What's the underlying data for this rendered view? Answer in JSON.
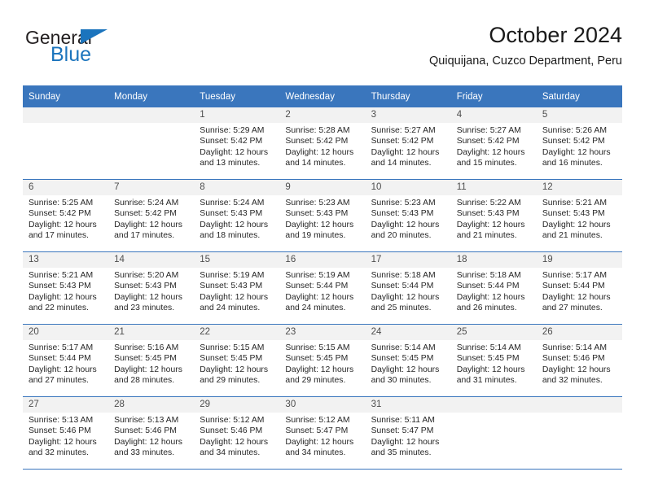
{
  "brand": {
    "name_part1": "General",
    "name_part2": "Blue",
    "accent_color": "#1b74bd"
  },
  "header": {
    "title": "October 2024",
    "subtitle": "Quiquijana, Cuzco Department, Peru"
  },
  "calendar": {
    "header_color": "#3a76bd",
    "weekday_headers": [
      "Sunday",
      "Monday",
      "Tuesday",
      "Wednesday",
      "Thursday",
      "Friday",
      "Saturday"
    ],
    "weeks": [
      [
        {
          "day": "",
          "empty": true,
          "sunrise": "",
          "sunset": "",
          "daylight": ""
        },
        {
          "day": "",
          "empty": true,
          "sunrise": "",
          "sunset": "",
          "daylight": ""
        },
        {
          "day": "1",
          "sunrise": "Sunrise: 5:29 AM",
          "sunset": "Sunset: 5:42 PM",
          "daylight": "Daylight: 12 hours and 13 minutes."
        },
        {
          "day": "2",
          "sunrise": "Sunrise: 5:28 AM",
          "sunset": "Sunset: 5:42 PM",
          "daylight": "Daylight: 12 hours and 14 minutes."
        },
        {
          "day": "3",
          "sunrise": "Sunrise: 5:27 AM",
          "sunset": "Sunset: 5:42 PM",
          "daylight": "Daylight: 12 hours and 14 minutes."
        },
        {
          "day": "4",
          "sunrise": "Sunrise: 5:27 AM",
          "sunset": "Sunset: 5:42 PM",
          "daylight": "Daylight: 12 hours and 15 minutes."
        },
        {
          "day": "5",
          "sunrise": "Sunrise: 5:26 AM",
          "sunset": "Sunset: 5:42 PM",
          "daylight": "Daylight: 12 hours and 16 minutes."
        }
      ],
      [
        {
          "day": "6",
          "sunrise": "Sunrise: 5:25 AM",
          "sunset": "Sunset: 5:42 PM",
          "daylight": "Daylight: 12 hours and 17 minutes."
        },
        {
          "day": "7",
          "sunrise": "Sunrise: 5:24 AM",
          "sunset": "Sunset: 5:42 PM",
          "daylight": "Daylight: 12 hours and 17 minutes."
        },
        {
          "day": "8",
          "sunrise": "Sunrise: 5:24 AM",
          "sunset": "Sunset: 5:43 PM",
          "daylight": "Daylight: 12 hours and 18 minutes."
        },
        {
          "day": "9",
          "sunrise": "Sunrise: 5:23 AM",
          "sunset": "Sunset: 5:43 PM",
          "daylight": "Daylight: 12 hours and 19 minutes."
        },
        {
          "day": "10",
          "sunrise": "Sunrise: 5:23 AM",
          "sunset": "Sunset: 5:43 PM",
          "daylight": "Daylight: 12 hours and 20 minutes."
        },
        {
          "day": "11",
          "sunrise": "Sunrise: 5:22 AM",
          "sunset": "Sunset: 5:43 PM",
          "daylight": "Daylight: 12 hours and 21 minutes."
        },
        {
          "day": "12",
          "sunrise": "Sunrise: 5:21 AM",
          "sunset": "Sunset: 5:43 PM",
          "daylight": "Daylight: 12 hours and 21 minutes."
        }
      ],
      [
        {
          "day": "13",
          "sunrise": "Sunrise: 5:21 AM",
          "sunset": "Sunset: 5:43 PM",
          "daylight": "Daylight: 12 hours and 22 minutes."
        },
        {
          "day": "14",
          "sunrise": "Sunrise: 5:20 AM",
          "sunset": "Sunset: 5:43 PM",
          "daylight": "Daylight: 12 hours and 23 minutes."
        },
        {
          "day": "15",
          "sunrise": "Sunrise: 5:19 AM",
          "sunset": "Sunset: 5:43 PM",
          "daylight": "Daylight: 12 hours and 24 minutes."
        },
        {
          "day": "16",
          "sunrise": "Sunrise: 5:19 AM",
          "sunset": "Sunset: 5:44 PM",
          "daylight": "Daylight: 12 hours and 24 minutes."
        },
        {
          "day": "17",
          "sunrise": "Sunrise: 5:18 AM",
          "sunset": "Sunset: 5:44 PM",
          "daylight": "Daylight: 12 hours and 25 minutes."
        },
        {
          "day": "18",
          "sunrise": "Sunrise: 5:18 AM",
          "sunset": "Sunset: 5:44 PM",
          "daylight": "Daylight: 12 hours and 26 minutes."
        },
        {
          "day": "19",
          "sunrise": "Sunrise: 5:17 AM",
          "sunset": "Sunset: 5:44 PM",
          "daylight": "Daylight: 12 hours and 27 minutes."
        }
      ],
      [
        {
          "day": "20",
          "sunrise": "Sunrise: 5:17 AM",
          "sunset": "Sunset: 5:44 PM",
          "daylight": "Daylight: 12 hours and 27 minutes."
        },
        {
          "day": "21",
          "sunrise": "Sunrise: 5:16 AM",
          "sunset": "Sunset: 5:45 PM",
          "daylight": "Daylight: 12 hours and 28 minutes."
        },
        {
          "day": "22",
          "sunrise": "Sunrise: 5:15 AM",
          "sunset": "Sunset: 5:45 PM",
          "daylight": "Daylight: 12 hours and 29 minutes."
        },
        {
          "day": "23",
          "sunrise": "Sunrise: 5:15 AM",
          "sunset": "Sunset: 5:45 PM",
          "daylight": "Daylight: 12 hours and 29 minutes."
        },
        {
          "day": "24",
          "sunrise": "Sunrise: 5:14 AM",
          "sunset": "Sunset: 5:45 PM",
          "daylight": "Daylight: 12 hours and 30 minutes."
        },
        {
          "day": "25",
          "sunrise": "Sunrise: 5:14 AM",
          "sunset": "Sunset: 5:45 PM",
          "daylight": "Daylight: 12 hours and 31 minutes."
        },
        {
          "day": "26",
          "sunrise": "Sunrise: 5:14 AM",
          "sunset": "Sunset: 5:46 PM",
          "daylight": "Daylight: 12 hours and 32 minutes."
        }
      ],
      [
        {
          "day": "27",
          "sunrise": "Sunrise: 5:13 AM",
          "sunset": "Sunset: 5:46 PM",
          "daylight": "Daylight: 12 hours and 32 minutes."
        },
        {
          "day": "28",
          "sunrise": "Sunrise: 5:13 AM",
          "sunset": "Sunset: 5:46 PM",
          "daylight": "Daylight: 12 hours and 33 minutes."
        },
        {
          "day": "29",
          "sunrise": "Sunrise: 5:12 AM",
          "sunset": "Sunset: 5:46 PM",
          "daylight": "Daylight: 12 hours and 34 minutes."
        },
        {
          "day": "30",
          "sunrise": "Sunrise: 5:12 AM",
          "sunset": "Sunset: 5:47 PM",
          "daylight": "Daylight: 12 hours and 34 minutes."
        },
        {
          "day": "31",
          "sunrise": "Sunrise: 5:11 AM",
          "sunset": "Sunset: 5:47 PM",
          "daylight": "Daylight: 12 hours and 35 minutes."
        },
        {
          "day": "",
          "empty": true,
          "sunrise": "",
          "sunset": "",
          "daylight": ""
        },
        {
          "day": "",
          "empty": true,
          "sunrise": "",
          "sunset": "",
          "daylight": ""
        }
      ]
    ]
  }
}
